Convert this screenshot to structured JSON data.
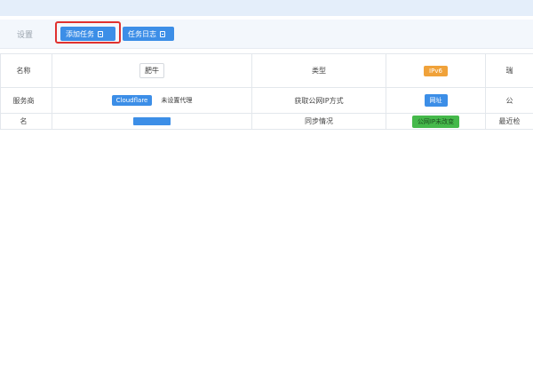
{
  "toolbar": {
    "settings_label": "设置",
    "add_task_label": "添加任务",
    "task_log_label": "任务日志"
  },
  "table": {
    "row1": {
      "label": "名称",
      "value": "肥牛",
      "type_label": "类型",
      "type_value": "IPv6",
      "extra_label": "瑞"
    },
    "row2": {
      "label": "服务商",
      "provider": "Cloudflare",
      "proxy_status": "未设置代理",
      "ip_method_label": "获取公网IP方式",
      "ip_method_value": "网址",
      "extra_label": "公"
    },
    "row3": {
      "label": "名",
      "sync_label": "同步情况",
      "sync_value": "公网IP未改变",
      "extra_label": "最近检"
    }
  },
  "colors": {
    "accent": "#3c8ee7",
    "highlight": "#e0312f",
    "badge_orange": "#f0a23a",
    "badge_green": "#45b94b"
  }
}
